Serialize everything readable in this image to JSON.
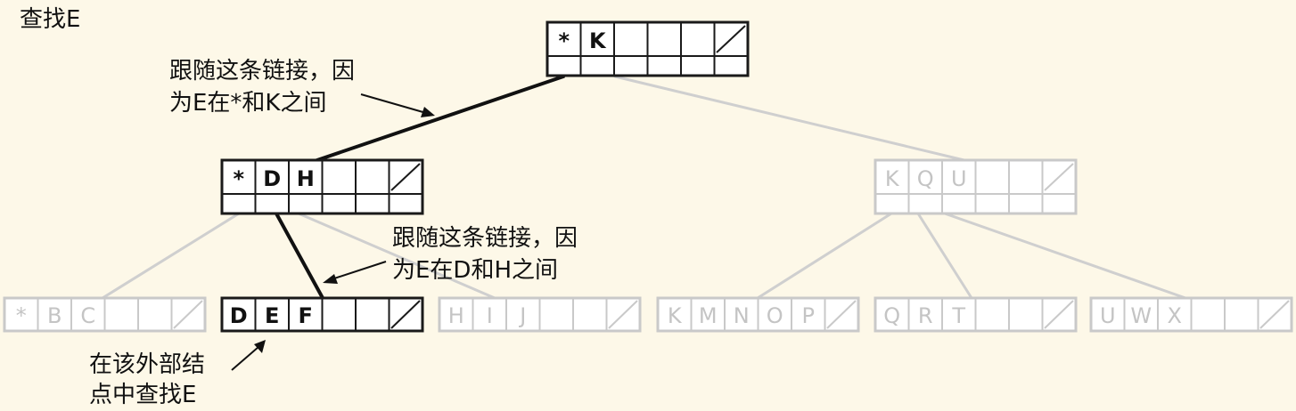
{
  "title": "查找E",
  "notes": {
    "root_follow": [
      "跟随这条链接，因",
      "为E在*和K之间"
    ],
    "mid_follow": [
      "跟随这条链接，因",
      "为E在D和H之间"
    ],
    "leaf_search": [
      "在该外部结",
      "点中查找E"
    ]
  },
  "nodes": {
    "root": {
      "keys": [
        "*",
        "K"
      ],
      "active": true
    },
    "left": {
      "keys": [
        "*",
        "D",
        "H"
      ],
      "active": true
    },
    "right": {
      "keys": [
        "K",
        "Q",
        "U"
      ],
      "active": false
    },
    "leaf1": {
      "keys": [
        "*",
        "B",
        "C"
      ],
      "active": false
    },
    "leaf2": {
      "keys": [
        "D",
        "E",
        "F"
      ],
      "active": true
    },
    "leaf3": {
      "keys": [
        "H",
        "I",
        "J"
      ],
      "active": false
    },
    "leaf4": {
      "keys": [
        "K",
        "M",
        "N",
        "O",
        "P"
      ],
      "active": false
    },
    "leaf5": {
      "keys": [
        "Q",
        "R",
        "T"
      ],
      "active": false
    },
    "leaf6": {
      "keys": [
        "U",
        "W",
        "X"
      ],
      "active": false
    }
  },
  "colors": {
    "background": "#fdf8e8",
    "active": "#111111",
    "inactive": "#c9c9c9"
  }
}
